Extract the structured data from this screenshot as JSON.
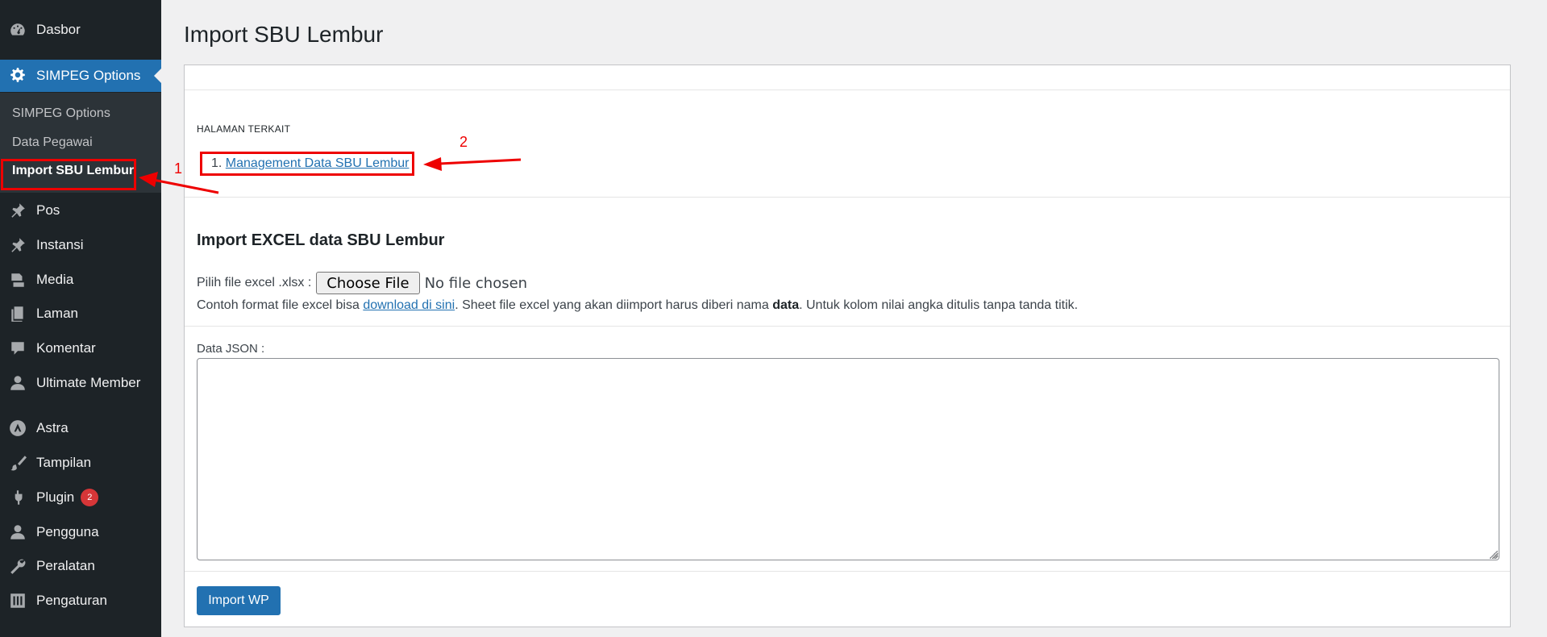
{
  "sidebar": {
    "dashboard": "Dasbor",
    "simpeg_options": "SIMPEG Options",
    "submenu": [
      "SIMPEG Options",
      "Data Pegawai",
      "Import SBU Lembur"
    ],
    "pos": "Pos",
    "instansi": "Instansi",
    "media": "Media",
    "laman": "Laman",
    "komentar": "Komentar",
    "ultimate_member": "Ultimate Member",
    "astra": "Astra",
    "tampilan": "Tampilan",
    "plugin": "Plugin",
    "plugin_badge": "2",
    "pengguna": "Pengguna",
    "peralatan": "Peralatan",
    "pengaturan": "Pengaturan"
  },
  "main": {
    "title": "Import SBU Lembur",
    "related_heading": "HALAMAN TERKAIT",
    "related_number": "1.",
    "related_link": "Management Data SBU Lembur",
    "section_heading": "Import EXCEL data SBU Lembur",
    "file_label": "Pilih file excel .xlsx :",
    "choose_file": "Choose File",
    "no_file": "No file chosen",
    "hint_pre": "Contoh format file excel bisa ",
    "hint_link": "download di sini",
    "hint_mid": ". Sheet file excel yang akan diimport harus diberi nama ",
    "hint_bold": "data",
    "hint_post": ". Untuk kolom nilai angka ditulis tanpa tanda titik.",
    "json_label": "Data JSON :",
    "json_value": "",
    "import_button": "Import WP"
  },
  "annotations": {
    "label_1": "1",
    "label_2": "2",
    "color": "#ee0000"
  },
  "colors": {
    "sidebar_bg": "#1d2327",
    "accent": "#2271b1",
    "badge": "#d63638"
  }
}
